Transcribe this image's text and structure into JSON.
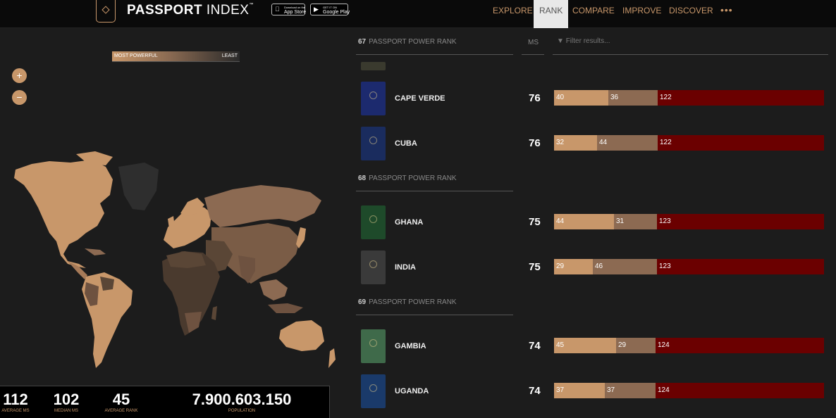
{
  "header": {
    "logo_bold": "PASSPORT",
    "logo_light": "INDEX",
    "logo_tm": "™",
    "app_store_small": "Download on the",
    "app_store_label": "App Store",
    "google_play_small": "GET IT ON",
    "google_play_label": "Google Play",
    "nav": [
      "EXPLORE",
      "RANK",
      "COMPARE",
      "IMPROVE",
      "DISCOVER"
    ],
    "active_nav": "RANK",
    "more": "•••"
  },
  "map": {
    "legend_left": "MOST POWERFUL",
    "legend_right": "LEAST",
    "zoom_in": "+",
    "zoom_out": "−"
  },
  "stats": [
    {
      "value": "112",
      "label": "AVERAGE MS"
    },
    {
      "value": "102",
      "label": "MEDIAN MS"
    },
    {
      "value": "45",
      "label": "AVERAGE RANK"
    },
    {
      "value": "7.900.603.150",
      "label": "POPULATION"
    }
  ],
  "rank_list": {
    "ms_header": "MS",
    "filter_placeholder": "Filter results...",
    "groups": [
      {
        "rank": "67",
        "label": "PASSPORT POWER RANK"
      },
      {
        "rank": "68",
        "label": "PASSPORT POWER RANK"
      },
      {
        "rank": "69",
        "label": "PASSPORT POWER RANK"
      }
    ],
    "rows": [
      {
        "country": "CAPE VERDE",
        "score": "76",
        "a": 40,
        "b": 36,
        "c": 122,
        "passport_color": "#1c2a6e"
      },
      {
        "country": "CUBA",
        "score": "76",
        "a": 32,
        "b": 44,
        "c": 122,
        "passport_color": "#1a2c5e"
      },
      {
        "country": "GHANA",
        "score": "75",
        "a": 44,
        "b": 31,
        "c": 123,
        "passport_color": "#1e4a2a"
      },
      {
        "country": "INDIA",
        "score": "75",
        "a": 29,
        "b": 46,
        "c": 123,
        "passport_color": "#3a3a3a"
      },
      {
        "country": "GAMBIA",
        "score": "74",
        "a": 45,
        "b": 29,
        "c": 124,
        "passport_color": "#3f6a4a"
      },
      {
        "country": "UGANDA",
        "score": "74",
        "a": 37,
        "b": 37,
        "c": 124,
        "passport_color": "#1a3a6a"
      }
    ]
  },
  "colors": {
    "accent": "#c8976a",
    "visa_free": "#c8976a",
    "visa_on_arrival": "#8c6a52",
    "visa_required": "#6b0000"
  }
}
